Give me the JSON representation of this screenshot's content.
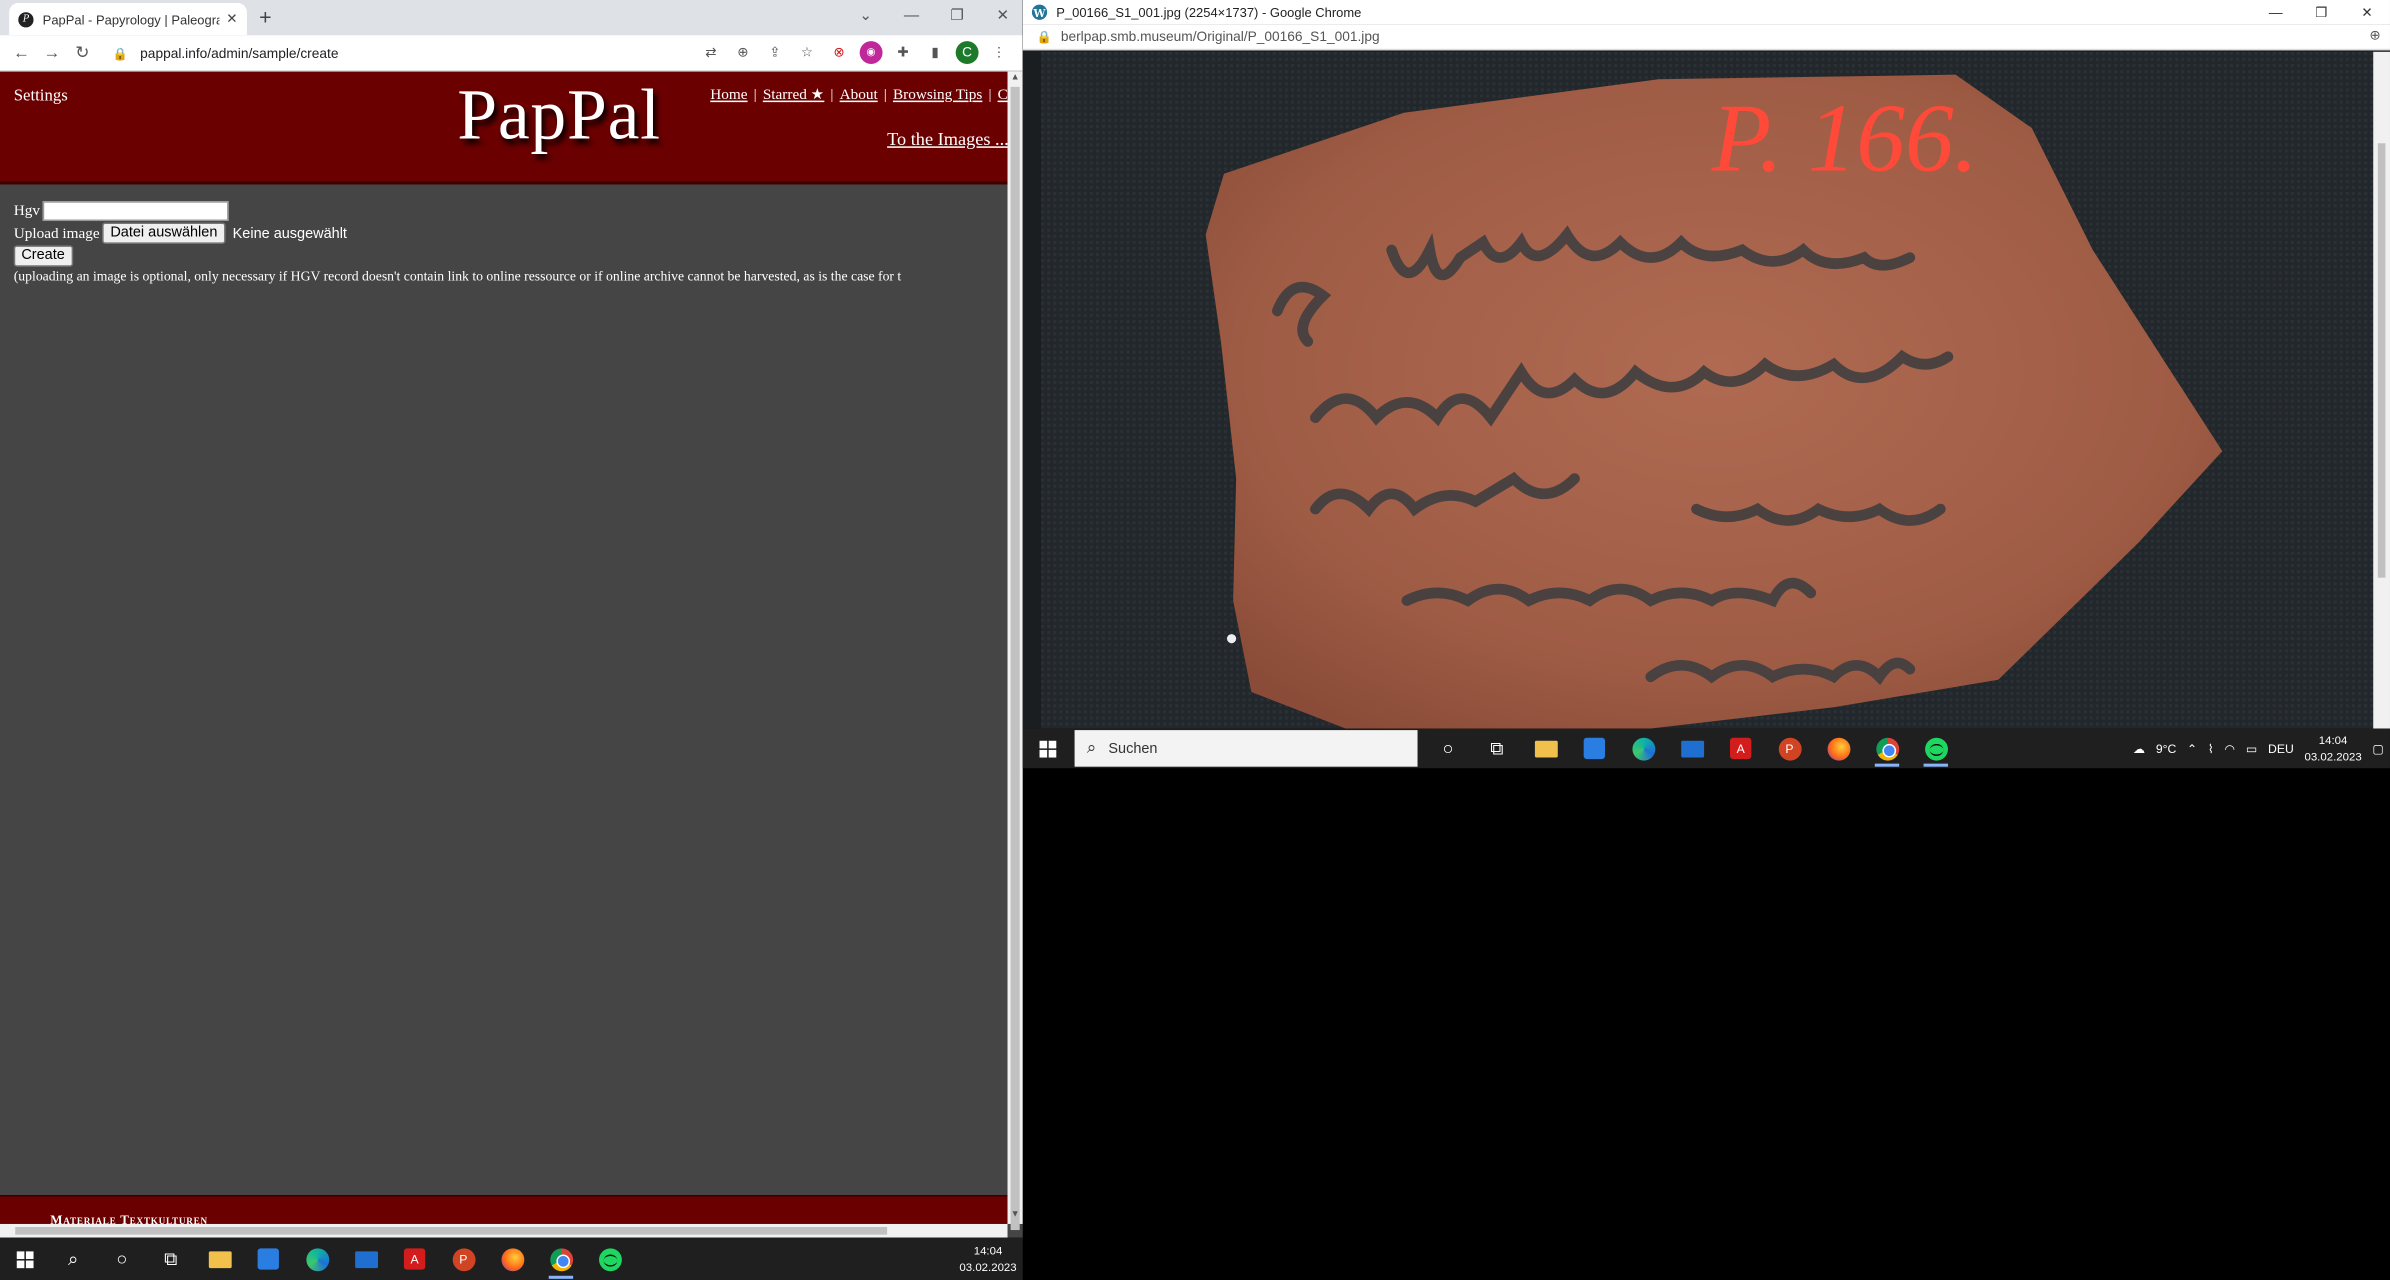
{
  "left_window": {
    "tab_title": "PapPal - Papyrology | Paleography",
    "tab_favicon": "P",
    "new_tab_glyph": "+",
    "url": "pappal.info/admin/sample/create",
    "avatar_letter": "C",
    "page": {
      "settings_label": "Settings",
      "logo": "PapPal",
      "nav": {
        "home": "Home",
        "starred": "Starred ★",
        "about": "About",
        "browsing_tips": "Browsing Tips",
        "cut": "C"
      },
      "to_images": "To the Images ...",
      "form": {
        "hgv_label": "Hgv",
        "hgv_value": "",
        "upload_label": "Upload image",
        "file_button": "Datei auswählen",
        "file_status": "Keine ausgewählt",
        "create_button": "Create",
        "note": "(uploading an image is optional, only necessary if HGV record doesn't contain link to online ressource or if online archive cannot be harvested, as is the case for t"
      },
      "footer_text": "Materiale Textkulturen"
    }
  },
  "right_window": {
    "title": "P_00166_S1_001.jpg (2254×1737) - Google Chrome",
    "url": "berlpap.smb.museum/Original/P_00166_S1_001.jpg",
    "ostracon_label": "P. 166."
  },
  "taskbar_left": {
    "time": "14:04",
    "date": "03.02.2023"
  },
  "taskbar_right": {
    "search_placeholder": "Suchen",
    "weather": "9°C",
    "language": "DEU",
    "time": "14:04",
    "date": "03.02.2023"
  },
  "colors": {
    "banner": "#6b0000",
    "page_bg": "#454545",
    "taskbar": "#1f1f1f",
    "ostracon": "#a8604a",
    "ostracon_label": "#ff4a3a"
  }
}
